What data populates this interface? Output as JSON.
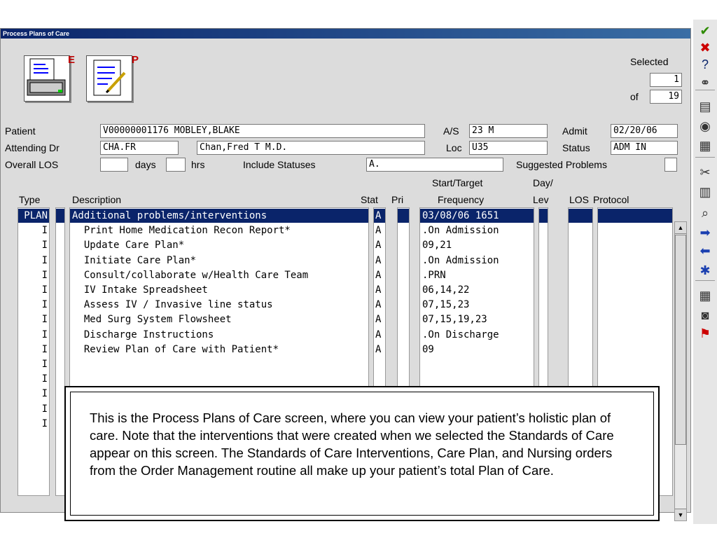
{
  "window": {
    "title": "Process Plans of Care"
  },
  "toolbar": {
    "e_letter": "E",
    "p_letter": "P"
  },
  "selection": {
    "selected_label": "Selected",
    "selected_value": "1",
    "of_label": "of",
    "of_value": "19"
  },
  "patient": {
    "patient_label": "Patient",
    "patient_value": "V00000001176 MOBLEY,BLAKE",
    "as_label": "A/S",
    "as_value": "23 M",
    "admit_label": "Admit",
    "admit_value": "02/20/06",
    "attending_label": "Attending Dr",
    "attending_code": "CHA.FR",
    "attending_name": "Chan,Fred T M.D.",
    "loc_label": "Loc",
    "loc_value": "U35",
    "status_label": "Status",
    "status_value": "ADM IN",
    "los_label": "Overall LOS",
    "days_label": "days",
    "hrs_label": "hrs",
    "include_label": "Include Statuses",
    "include_value": "A.",
    "suggested_label": "Suggested Problems"
  },
  "table": {
    "headers": {
      "type": "Type",
      "description": "Description",
      "stat": "Stat",
      "pri": "Pri",
      "start_target": "Start/Target",
      "frequency": "Frequency",
      "day": "Day/",
      "lev": "Lev",
      "los": "LOS",
      "protocol": "Protocol"
    },
    "rows": [
      {
        "type": "PLAN",
        "description": "Additional problems/interventions",
        "stat": "A",
        "frequency": "03/08/06 1651"
      },
      {
        "type": "I",
        "description": "  Print Home Medication Recon Report*",
        "stat": "A",
        "frequency": ".On Admission"
      },
      {
        "type": "I",
        "description": "  Update Care Plan*",
        "stat": "A",
        "frequency": "09,21"
      },
      {
        "type": "I",
        "description": "  Initiate Care Plan*",
        "stat": "A",
        "frequency": ".On Admission"
      },
      {
        "type": "I",
        "description": "  Consult/collaborate w/Health Care Team",
        "stat": "A",
        "frequency": ".PRN"
      },
      {
        "type": "I",
        "description": "  IV Intake Spreadsheet",
        "stat": "A",
        "frequency": "06,14,22"
      },
      {
        "type": "I",
        "description": "  Assess IV / Invasive line status",
        "stat": "A",
        "frequency": "07,15,23"
      },
      {
        "type": "I",
        "description": "  Med Surg System Flowsheet",
        "stat": "A",
        "frequency": "07,15,19,23"
      },
      {
        "type": "I",
        "description": "  Discharge Instructions",
        "stat": "A",
        "frequency": ".On Discharge"
      },
      {
        "type": "I",
        "description": "  Review Plan of Care with Patient*",
        "stat": "A",
        "frequency": "09"
      },
      {
        "type": "I",
        "description": "",
        "stat": "",
        "frequency": ""
      },
      {
        "type": "I",
        "description": "",
        "stat": "",
        "frequency": ""
      },
      {
        "type": "I",
        "description": "",
        "stat": "",
        "frequency": ""
      },
      {
        "type": "I",
        "description": "",
        "stat": "",
        "frequency": ""
      },
      {
        "type": "I",
        "description": "",
        "stat": "",
        "frequency": ""
      }
    ]
  },
  "sidebar": {
    "icons": [
      "checkmark-icon",
      "close-icon",
      "help-icon",
      "binoculars-icon",
      "print-icon",
      "web-icon",
      "delete-icon",
      "cut-icon",
      "copy-icon",
      "search-icon",
      "next-icon",
      "previous-icon",
      "asterisk-icon",
      "calculator-icon",
      "camera-icon",
      "tools-icon"
    ],
    "glyphs": [
      "✔",
      "✖",
      "?",
      "⚭",
      "▤",
      "◉",
      "▦",
      "✂",
      "▥",
      "⌕",
      "➡",
      "⬅",
      "✱",
      "▦",
      "◙",
      "⚑"
    ],
    "colors": {
      "check": "#2e8b00",
      "close": "#cc0000",
      "help": "#0a246a",
      "arrow": "#1a3fb0"
    }
  },
  "note": {
    "text": "This is the Process Plans of Care screen, where you can view your patient’s holistic plan of care.  Note that the interventions that were created when we selected the Standards of Care appear on this screen. The Standards of Care Interventions, Care Plan, and Nursing orders from the Order Management routine all make up your patient’s total Plan of Care."
  }
}
